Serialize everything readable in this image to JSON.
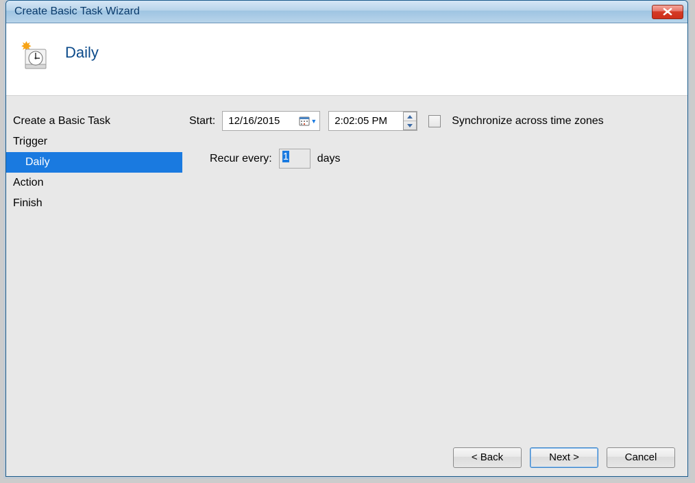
{
  "window": {
    "title": "Create Basic Task Wizard"
  },
  "header": {
    "title": "Daily"
  },
  "sidebar": {
    "items": [
      {
        "label": "Create a Basic Task"
      },
      {
        "label": "Trigger"
      },
      {
        "label": "Daily"
      },
      {
        "label": "Action"
      },
      {
        "label": "Finish"
      }
    ]
  },
  "form": {
    "start_label": "Start:",
    "date": "12/16/2015",
    "time": "2:02:05 PM",
    "sync_label": "Synchronize across time zones",
    "recur_label": "Recur every:",
    "recur_value": "1",
    "days_label": "days"
  },
  "footer": {
    "back": "< Back",
    "next": "Next >",
    "cancel": "Cancel"
  }
}
